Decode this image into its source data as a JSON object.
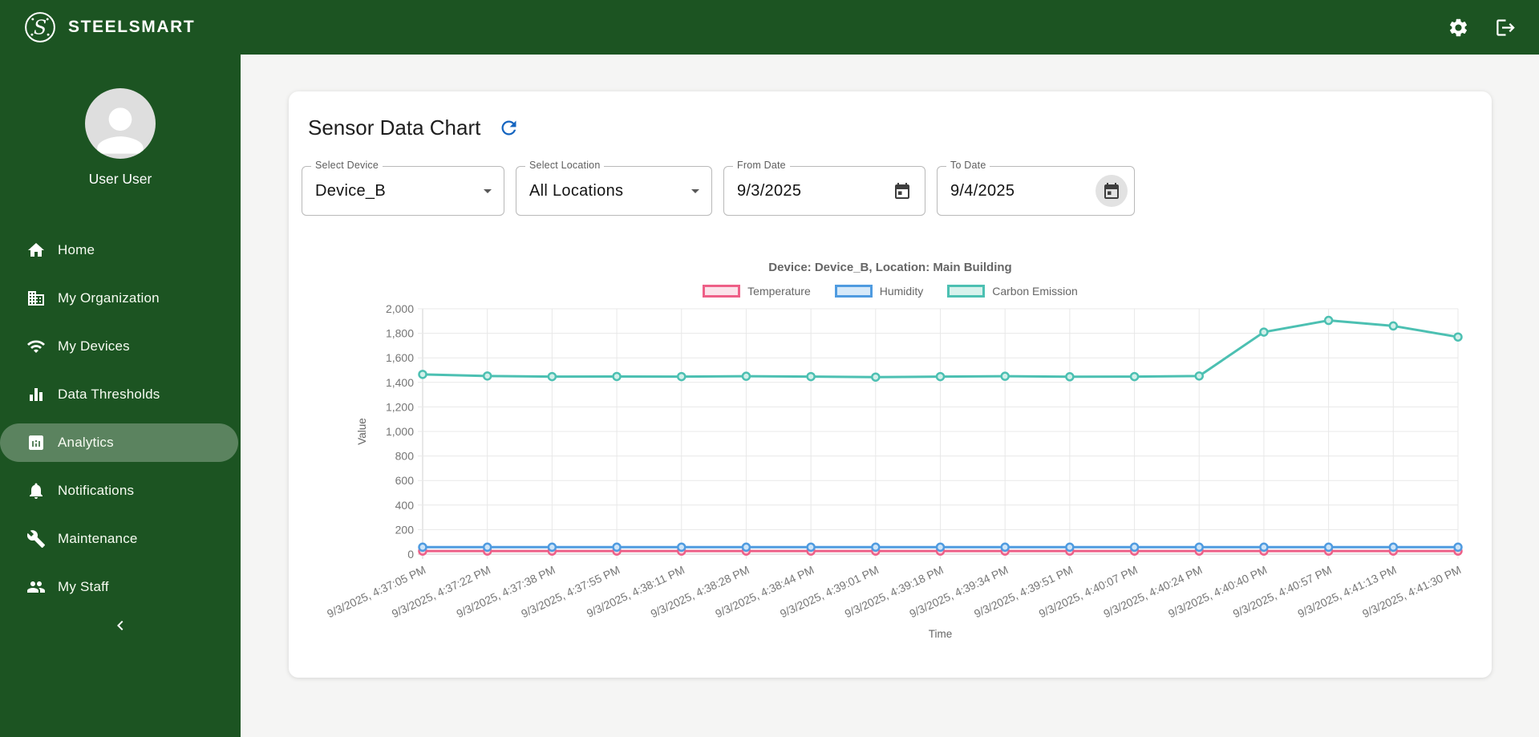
{
  "app": {
    "brand": "STEELSMART"
  },
  "topbar": {
    "icons": [
      "settings-icon",
      "logout-icon"
    ]
  },
  "sidebar": {
    "user_name": "User User",
    "items": [
      {
        "label": "Home",
        "icon": "home-icon",
        "active": false
      },
      {
        "label": "My Organization",
        "icon": "organization-icon",
        "active": false
      },
      {
        "label": "My Devices",
        "icon": "wifi-icon",
        "active": false
      },
      {
        "label": "Data Thresholds",
        "icon": "bar-chart-icon",
        "active": false
      },
      {
        "label": "Analytics",
        "icon": "analytics-icon",
        "active": true
      },
      {
        "label": "Notifications",
        "icon": "bell-icon",
        "active": false
      },
      {
        "label": "Maintenance",
        "icon": "wrench-icon",
        "active": false
      },
      {
        "label": "My Staff",
        "icon": "people-icon",
        "active": false
      }
    ],
    "collapse_icon": "chevron-left-icon"
  },
  "card": {
    "title": "Sensor Data Chart",
    "refresh_icon": "refresh-icon",
    "filters": {
      "device": {
        "label": "Select Device",
        "value": "Device_B"
      },
      "location": {
        "label": "Select Location",
        "value": "All Locations"
      },
      "from_date": {
        "label": "From Date",
        "value": "9/3/2025"
      },
      "to_date": {
        "label": "To Date",
        "value": "9/4/2025"
      }
    }
  },
  "chart_data": {
    "type": "line",
    "title": "Device: Device_B, Location: Main Building",
    "xlabel": "Time",
    "ylabel": "Value",
    "ylim": [
      0,
      2000
    ],
    "ytick_step": 200,
    "grid": true,
    "legend_position": "top",
    "categories": [
      "9/3/2025, 4:37:05 PM",
      "9/3/2025, 4:37:22 PM",
      "9/3/2025, 4:37:38 PM",
      "9/3/2025, 4:37:55 PM",
      "9/3/2025, 4:38:11 PM",
      "9/3/2025, 4:38:28 PM",
      "9/3/2025, 4:38:44 PM",
      "9/3/2025, 4:39:01 PM",
      "9/3/2025, 4:39:18 PM",
      "9/3/2025, 4:39:34 PM",
      "9/3/2025, 4:39:51 PM",
      "9/3/2025, 4:40:07 PM",
      "9/3/2025, 4:40:24 PM",
      "9/3/2025, 4:40:40 PM",
      "9/3/2025, 4:40:57 PM",
      "9/3/2025, 4:41:13 PM",
      "9/3/2025, 4:41:30 PM"
    ],
    "series": [
      {
        "name": "Temperature",
        "color": "#ee5f87",
        "fill": "#fbe3ea",
        "point_fill": "#f9cfdc",
        "values": [
          25,
          25,
          25,
          25,
          25,
          25,
          25,
          25,
          25,
          25,
          25,
          25,
          25,
          25,
          25,
          25,
          25
        ]
      },
      {
        "name": "Humidity",
        "color": "#4f9be0",
        "fill": "#d6e9f9",
        "point_fill": "#cde4f8",
        "values": [
          57,
          57,
          57,
          57,
          57,
          57,
          57,
          57,
          57,
          57,
          57,
          57,
          57,
          57,
          57,
          57,
          57
        ]
      },
      {
        "name": "Carbon Emission",
        "color": "#4cc0b2",
        "fill": "#d7f2ec",
        "point_fill": "#d2f0ea",
        "values": [
          1465,
          1452,
          1447,
          1448,
          1447,
          1450,
          1447,
          1443,
          1447,
          1450,
          1446,
          1447,
          1452,
          1810,
          1905,
          1860,
          1770
        ]
      }
    ]
  }
}
